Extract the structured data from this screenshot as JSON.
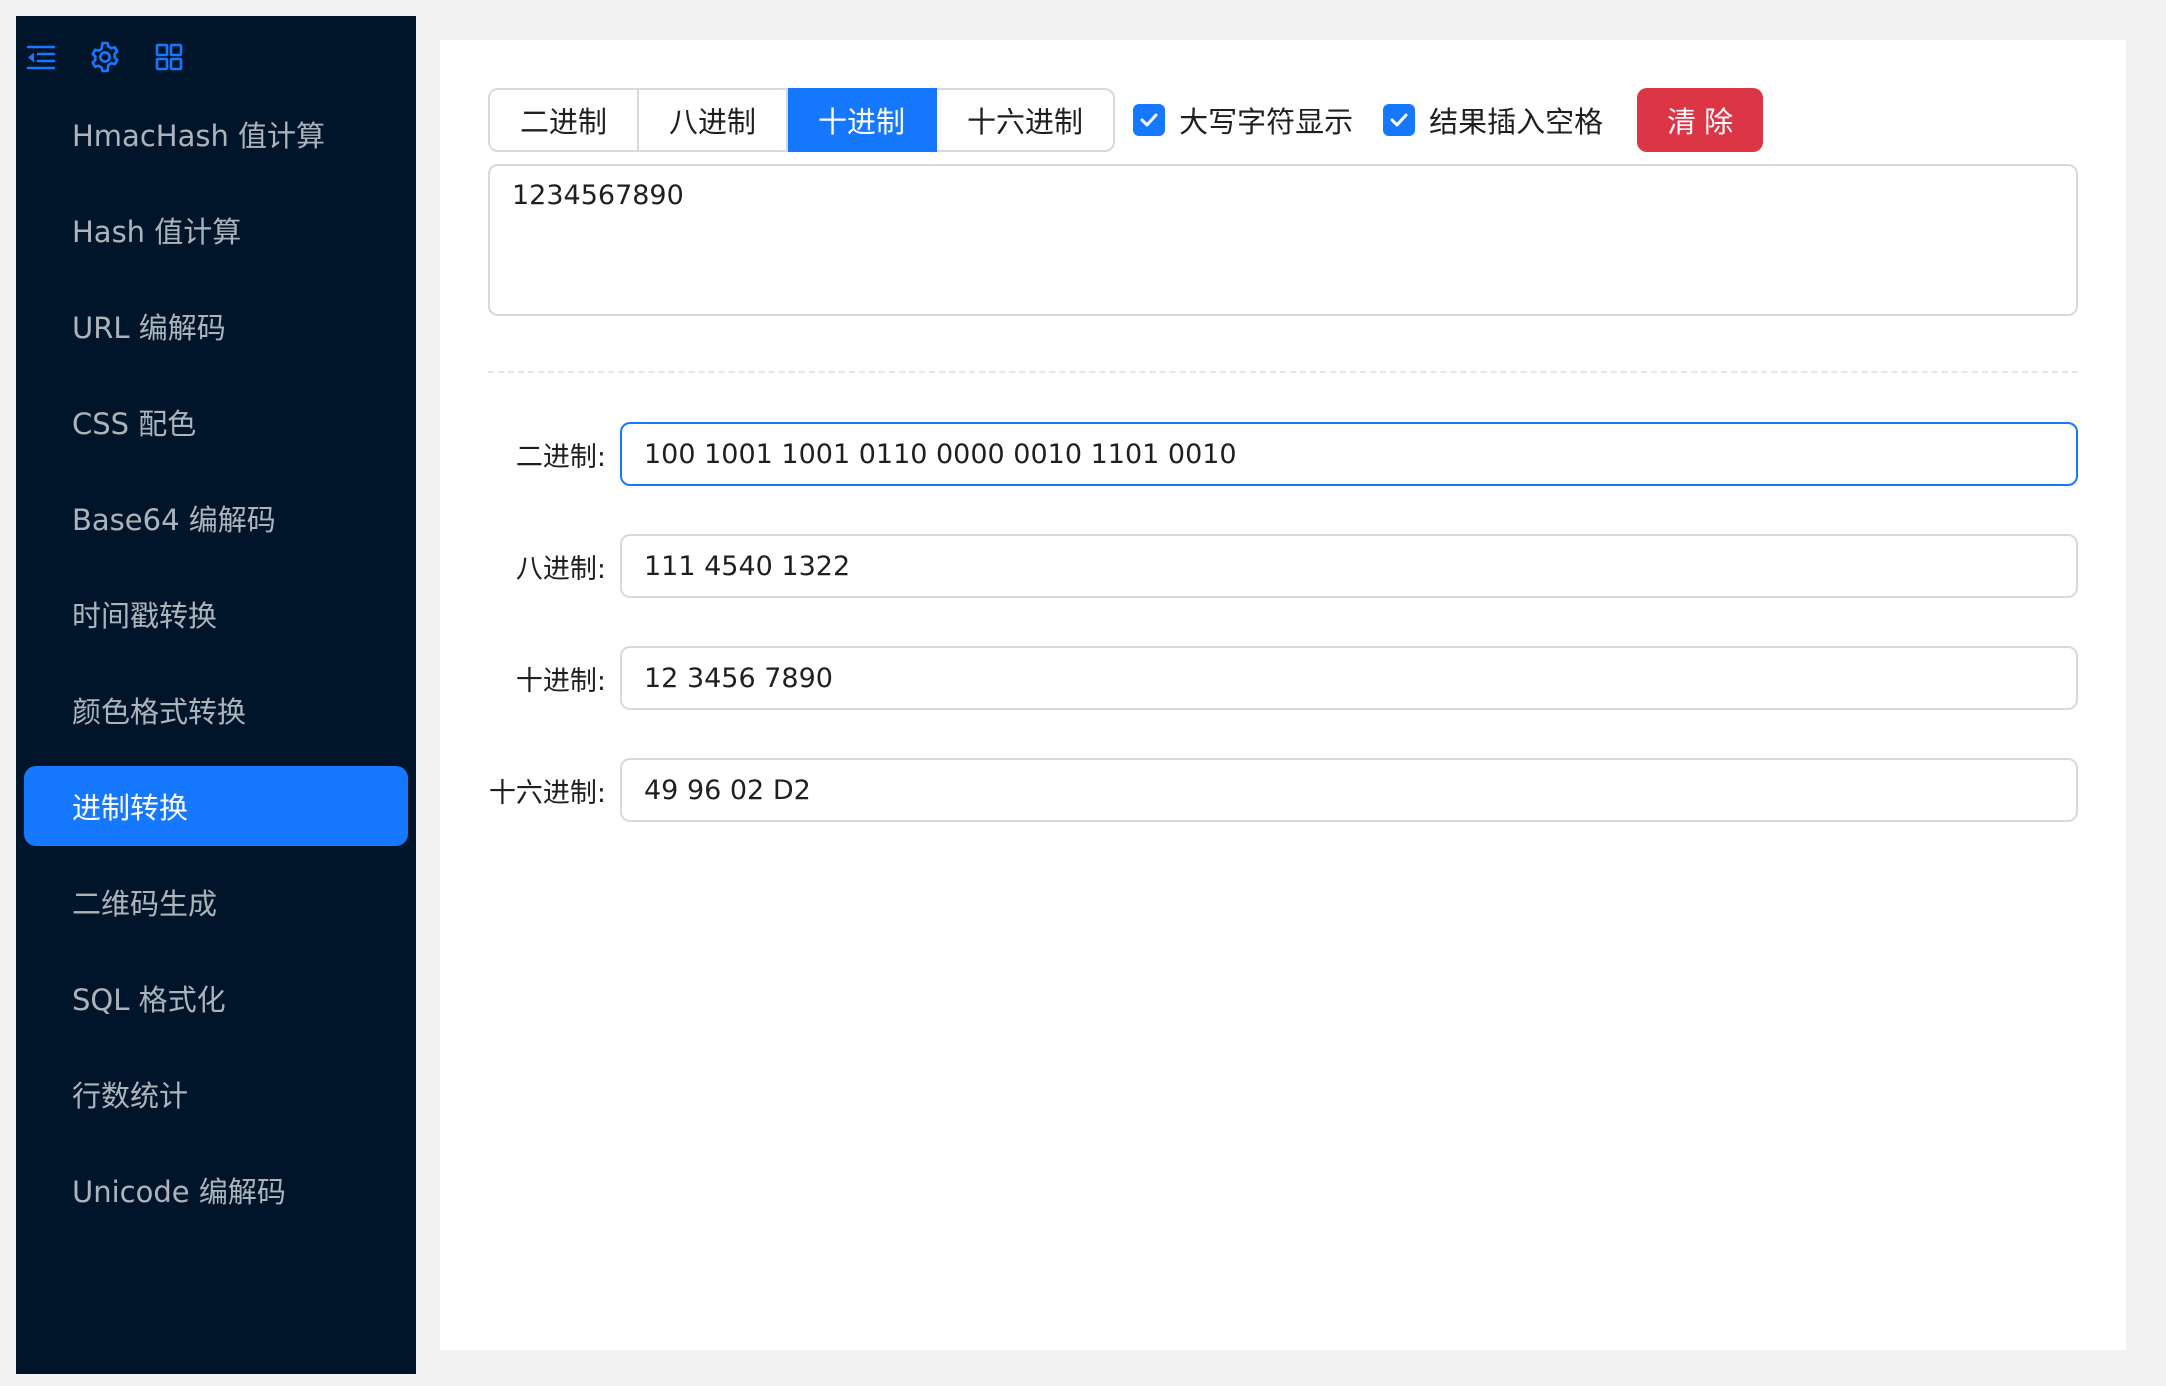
{
  "sidebar": {
    "icons": [
      "menu-fold-icon",
      "gear-icon",
      "grid-icon"
    ],
    "items": [
      {
        "label": "HmacHash 值计算"
      },
      {
        "label": "Hash 值计算"
      },
      {
        "label": "URL 编解码"
      },
      {
        "label": "CSS 配色"
      },
      {
        "label": "Base64 编解码"
      },
      {
        "label": "时间戳转换"
      },
      {
        "label": "颜色格式转换"
      },
      {
        "label": "进制转换"
      },
      {
        "label": "二维码生成"
      },
      {
        "label": "SQL 格式化"
      },
      {
        "label": "行数统计"
      },
      {
        "label": "Unicode 编解码"
      }
    ],
    "active_index": 7
  },
  "toolbar": {
    "segments": [
      "二进制",
      "八进制",
      "十进制",
      "十六进制"
    ],
    "active_segment": "十进制",
    "uppercase_label": "大写字符显示",
    "uppercase_checked": true,
    "space_label": "结果插入空格",
    "space_checked": true,
    "clear_label": "清 除"
  },
  "input": {
    "value": "1234567890"
  },
  "results": [
    {
      "label": "二进制:",
      "value": "100 1001 1001 0110 0000 0010 1101 0010"
    },
    {
      "label": "八进制:",
      "value": "111 4540 1322"
    },
    {
      "label": "十进制:",
      "value": "12 3456 7890"
    },
    {
      "label": "十六进制:",
      "value": "49 96 02 D2"
    }
  ],
  "colors": {
    "sidebar_bg": "#001529",
    "accent": "#1677ff",
    "danger": "#dc3545"
  }
}
